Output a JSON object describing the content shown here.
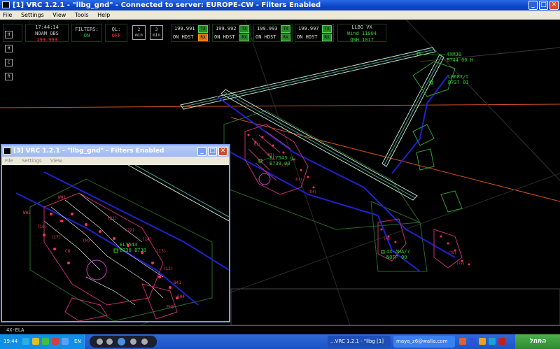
{
  "main_window": {
    "title": "[1] VRC 1.2.1 - \"llbg_gnd\" - Connected to server: EUROPE-CW - Filters Enabled",
    "menu": [
      "File",
      "Settings",
      "View",
      "Tools",
      "Help"
    ]
  },
  "hud": {
    "buttons_left": [
      "H",
      "M",
      "C",
      "R"
    ],
    "time": "17:44:14",
    "callsign": "NOAM_OBS",
    "prim_freq": "199.999",
    "filters_label": "FILTERS:",
    "filters_value": "ON",
    "ql_label": "QL:",
    "ql_value": "OFF",
    "timer_2": "2",
    "timer_3": "3",
    "timer_unit": "min",
    "freqs": [
      {
        "freq": "199.991",
        "mode": "ON HDST",
        "tx": "TX",
        "rx": "RX",
        "rx_color": "#e07020"
      },
      {
        "freq": "199.992",
        "mode": "ON HDST",
        "tx": "TX",
        "rx": "RX",
        "rx_color": "#2a8a2a"
      },
      {
        "freq": "199.993",
        "mode": "ON HDST",
        "tx": "TX",
        "rx": "RX",
        "rx_color": "#2a8a2a"
      },
      {
        "freq": "199.997",
        "mode": "ON HDST",
        "tx": "TX",
        "rx": "RX",
        "rx_color": "#2a8a2a"
      }
    ],
    "atis_station": "LLBG VX",
    "wind": "Wind 11004",
    "qnh": "QNH 1017"
  },
  "radar_labels": {
    "main": [
      {
        "id": "4xmjb",
        "line1": "4XMJB",
        "line2": "B744 00 H"
      },
      {
        "id": "lh687",
        "line1": "LH687/t",
        "line2": "B737 01"
      },
      {
        "id": "ely543",
        "line1": "ELY543 g",
        "line2": "B738 00"
      },
      {
        "id": "4xaha",
        "line1": "4X-AHA/?",
        "line2": "NOFP 00"
      }
    ],
    "sub": [
      {
        "id": "ely543-sub",
        "line1": "ELY543",
        "line2": "B738 B738"
      }
    ]
  },
  "sub_window": {
    "title": "[3] VRC 1.2.1 - \"llbg_gnd\" - Filters Enabled",
    "menu": [
      "File",
      "Settings",
      "View"
    ]
  },
  "command_line": {
    "callsign": "4X-ELA"
  },
  "taskbar": {
    "clock": "19:44",
    "lang": "EN",
    "tasks": [
      {
        "label": "...VRC 1.2.1 - \"llbg [1]",
        "active": true
      },
      {
        "label": "maya_z6@walla.com",
        "active": false
      }
    ],
    "start": "התחל"
  }
}
